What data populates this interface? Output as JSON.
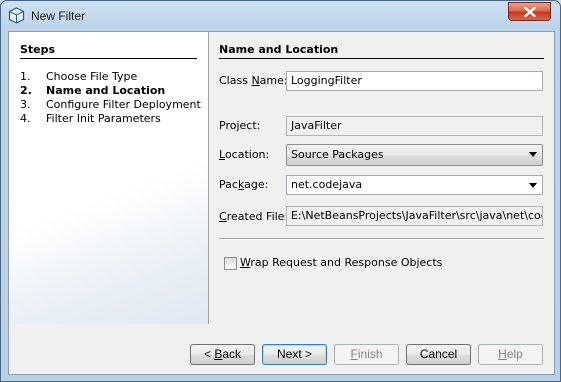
{
  "window": {
    "title": "New Filter"
  },
  "steps": {
    "title": "Steps",
    "items": [
      {
        "num": "1.",
        "label": "Choose File Type"
      },
      {
        "num": "2.",
        "label": "Name and Location"
      },
      {
        "num": "3.",
        "label": "Configure Filter Deployment"
      },
      {
        "num": "4.",
        "label": "Filter Init Parameters"
      }
    ],
    "current_index": 1
  },
  "form": {
    "title": "Name and Location",
    "class_name": {
      "label_pre": "Class ",
      "label_mn": "N",
      "label_post": "ame:",
      "value": "LoggingFilter"
    },
    "project": {
      "label": "Project:",
      "value": "JavaFilter"
    },
    "location": {
      "label_mn": "L",
      "label_post": "ocation:",
      "value": "Source Packages"
    },
    "package": {
      "label_pre": "Pac",
      "label_mn": "k",
      "label_post": "age:",
      "value": "net.codejava"
    },
    "created_file": {
      "label_mn": "C",
      "label_post": "reated File:",
      "value": "E:\\NetBeansProjects\\JavaFilter\\src\\java\\net\\codejava\\LoggingFilter.java"
    },
    "wrap_checkbox": {
      "label_mn": "W",
      "label_post": "rap Request and Response Objects",
      "checked": false
    }
  },
  "buttons": {
    "back_pre": "< ",
    "back_mn": "B",
    "back_post": "ack",
    "next": "Next >",
    "finish_mn": "F",
    "finish_post": "inish",
    "cancel": "Cancel",
    "help_mn": "H",
    "help_post": "elp"
  }
}
